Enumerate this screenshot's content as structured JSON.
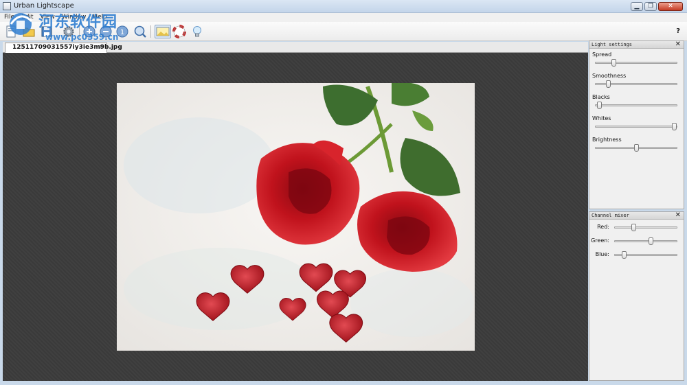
{
  "window": {
    "title": "Urban Lightscape"
  },
  "menu": [
    "File",
    "Edit",
    "View",
    "Window",
    "Help"
  ],
  "toolbar": {
    "help_label": "?"
  },
  "watermark": {
    "text": "河东软件园",
    "url": "www.pc0359.cn"
  },
  "document": {
    "tab_label": "12511709031557iy3ie3m9b.jpg",
    "tab_close": "×"
  },
  "light_settings": {
    "title": "Light settings",
    "close": "✕",
    "sliders": [
      {
        "label": "Spread",
        "value": 0.22
      },
      {
        "label": "Smoothness",
        "value": 0.15
      },
      {
        "label": "Blacks",
        "value": 0.04
      },
      {
        "label": "Whites",
        "value": 0.97
      },
      {
        "label": "Brightness",
        "value": 0.5
      }
    ]
  },
  "channel_mixer": {
    "title": "Channel mixer",
    "close": "✕",
    "sliders": [
      {
        "label": "Red:",
        "value": 0.3
      },
      {
        "label": "Green:",
        "value": 0.58
      },
      {
        "label": "Blue:",
        "value": 0.14
      }
    ]
  },
  "colors": {
    "canvas": "#3c3c3c",
    "accent": "#2f7ed1",
    "rose": "#c8101a"
  }
}
